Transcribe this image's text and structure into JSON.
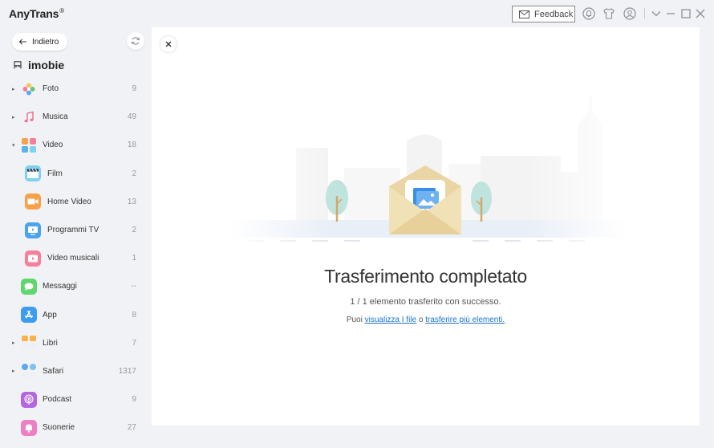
{
  "app": {
    "title": "AnyTrans",
    "reg_mark": "®"
  },
  "titlebar": {
    "feedback_label": "Feedback"
  },
  "sidebar": {
    "back_label": "Indietro",
    "device_name": "imobie",
    "items": [
      {
        "label": "Foto",
        "count": "9",
        "arrow": "▸",
        "icon": "photos-icon",
        "color": "#f6a3b5"
      },
      {
        "label": "Musica",
        "count": "49",
        "arrow": "▸",
        "icon": "music-note-icon",
        "color": "#ffffff"
      },
      {
        "label": "Video",
        "count": "18",
        "arrow": "▾",
        "icon": "video-icon",
        "color": "#5ab4ea"
      },
      {
        "label": "Film",
        "count": "2",
        "icon": "clapperboard-icon",
        "color": "#7fd0f2"
      },
      {
        "label": "Home Video",
        "count": "13",
        "icon": "home-video-icon",
        "color": "#f7a24b"
      },
      {
        "label": "Programmi TV",
        "count": "2",
        "icon": "tv-icon",
        "color": "#4aa3ef"
      },
      {
        "label": "Video musicali",
        "count": "1",
        "icon": "music-video-icon",
        "color": "#f6809b"
      },
      {
        "label": "Messaggi",
        "count": "--",
        "icon": "messages-icon",
        "color": "#5fd66e"
      },
      {
        "label": "App",
        "count": "8",
        "icon": "app-store-icon",
        "color": "#3d9cf1"
      },
      {
        "label": "Libri",
        "count": "7",
        "arrow": "▸",
        "icon": "books-icon",
        "color": "#f7b24b"
      },
      {
        "label": "Safari",
        "count": "1317",
        "arrow": "▸",
        "icon": "safari-icon",
        "color": "#4d9cf0"
      },
      {
        "label": "Podcast",
        "count": "9",
        "icon": "podcast-icon",
        "color": "#b567e0"
      },
      {
        "label": "Suonerie",
        "count": "27",
        "icon": "ringtones-icon",
        "color": "#ee7fc4"
      }
    ]
  },
  "main": {
    "title": "Trasferimento completato",
    "message": "1 / 1 elemento trasferito con successo.",
    "links_prefix": "Puoi",
    "link_view": "visualizza I file",
    "links_middle": "o",
    "link_more": "trasferire più elementi."
  }
}
